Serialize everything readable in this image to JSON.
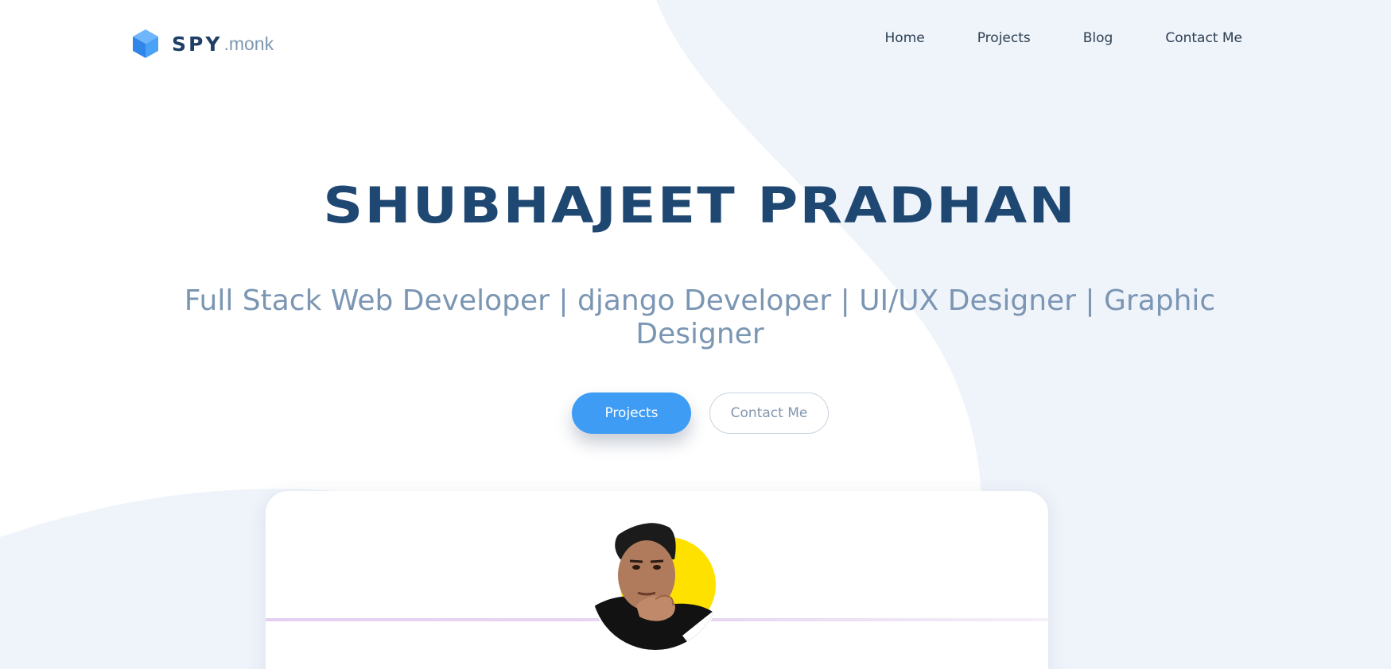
{
  "brand": {
    "name": "SPY",
    "suffix": ".monk",
    "icon": "cube-icon",
    "accent": "#3e9cf5"
  },
  "nav": {
    "items": [
      {
        "label": "Home"
      },
      {
        "label": "Projects"
      },
      {
        "label": "Blog"
      },
      {
        "label": "Contact Me"
      }
    ]
  },
  "hero": {
    "name": "SHUBHAJEET PRADHAN",
    "tagline": "Full Stack Web Developer | django Developer | UI/UX Designer | Graphic Designer",
    "primary_button": "Projects",
    "secondary_button": "Contact Me"
  },
  "profile": {
    "avatar": "profile-photo",
    "avatar_accent": "#ffe100"
  },
  "colors": {
    "background_shape": "#eff3fa",
    "title": "#1e4872",
    "subtitle": "#7b96b3"
  }
}
